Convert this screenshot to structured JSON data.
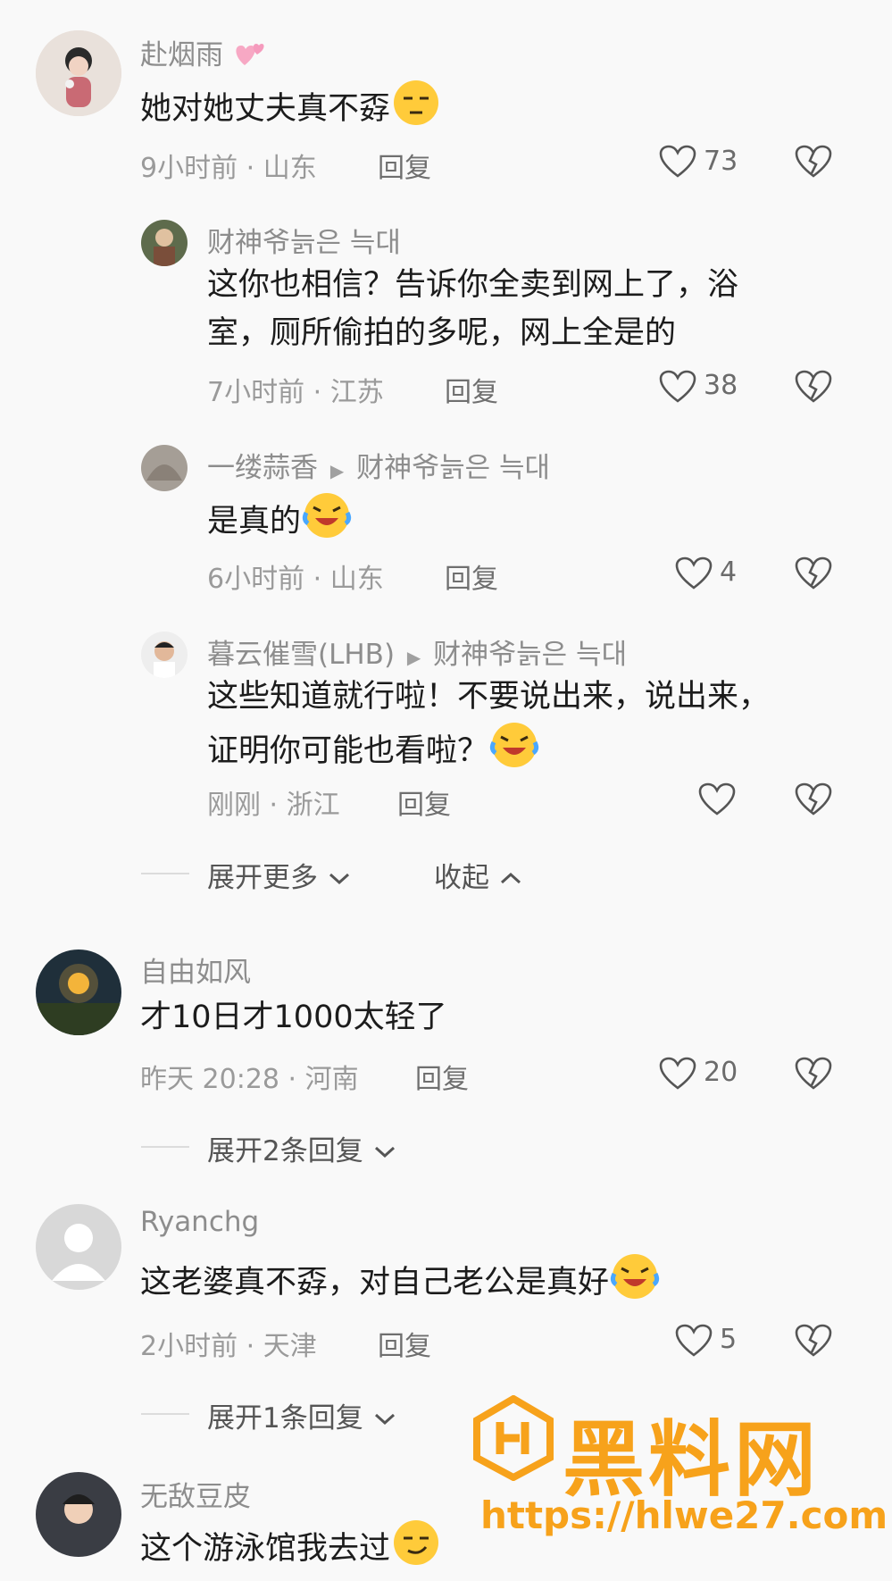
{
  "comments": [
    {
      "name": "赴烟雨",
      "text": "她对她丈夫真不孬",
      "time": "9小时前",
      "region": "山东",
      "reply": "回复",
      "likes": "73"
    },
    {
      "name": "自由如风",
      "text": "才10日才1000太轻了",
      "time": "昨天 20:28",
      "region": "河南",
      "reply": "回复",
      "likes": "20",
      "expand": "展开2条回复"
    },
    {
      "name": "Ryanchg",
      "text": "这老婆真不孬，对自己老公是真好",
      "time": "2小时前",
      "region": "天津",
      "reply": "回复",
      "likes": "5",
      "expand": "展开1条回复"
    },
    {
      "name": "无敌豆皮",
      "text": "这个游泳馆我去过"
    }
  ],
  "replies": [
    {
      "name": "财神爷늙은 늑대",
      "line1": "这你也相信？告诉你全卖到网上了，浴",
      "line2": "室，厕所偷拍的多呢，网上全是的",
      "time": "7小时前",
      "region": "江苏",
      "reply": "回复",
      "likes": "38"
    },
    {
      "name": "一缕蒜香",
      "target": "财神爷늙은 늑대",
      "line1": "是真的",
      "time": "6小时前",
      "region": "山东",
      "reply": "回复",
      "likes": "4"
    },
    {
      "name": "暮云催雪(LHB)",
      "target": "财神爷늙은 늑대",
      "line1": "这些知道就行啦！不要说出来，说出来，",
      "line2": "证明你可能也看啦？",
      "time": "刚刚",
      "region": "浙江",
      "reply": "回复",
      "likes": ""
    }
  ],
  "thread_controls": {
    "more": "展开更多",
    "collapse": "收起"
  },
  "separator": "·",
  "watermark": {
    "brand": "黑料网",
    "url": "https://hlwe27.com",
    "color": "#f7a21b"
  },
  "colors": {
    "background": "#f9f9f9",
    "meta": "#9a9a9a",
    "text": "#1c1c1c"
  }
}
